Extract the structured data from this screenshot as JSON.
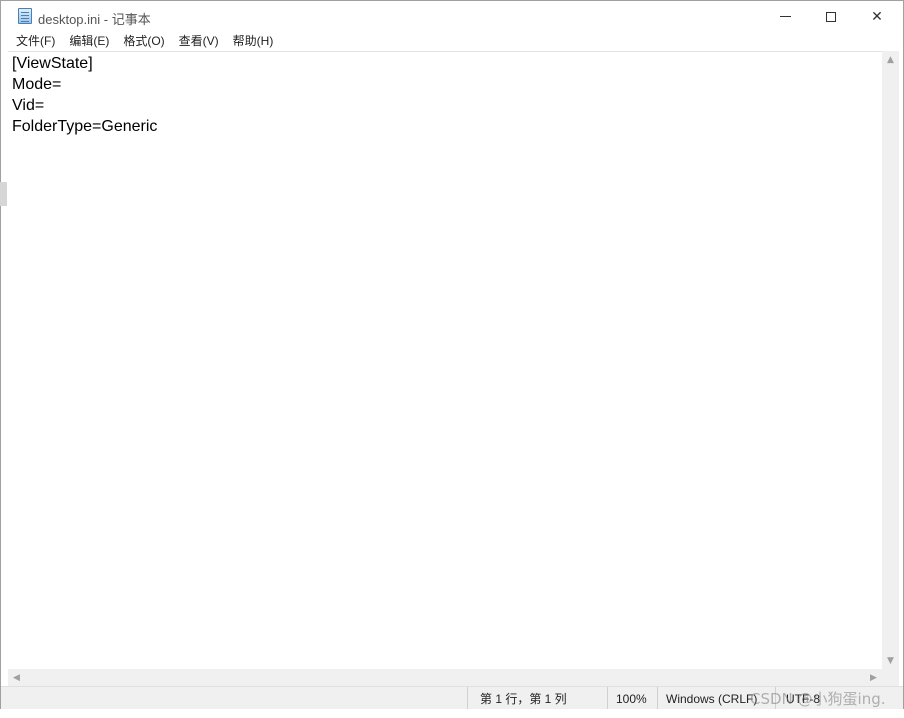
{
  "window": {
    "title": "desktop.ini - 记事本"
  },
  "menu": [
    {
      "label": "文件(F)"
    },
    {
      "label": "编辑(E)"
    },
    {
      "label": "格式(O)"
    },
    {
      "label": "查看(V)"
    },
    {
      "label": "帮助(H)"
    }
  ],
  "editor": {
    "lines": [
      "[ViewState]",
      "Mode=",
      "Vid=",
      "FolderType=Generic"
    ]
  },
  "status": {
    "position": "第 1 行，第 1 列",
    "zoom": "100%",
    "line_ending": "Windows (CRLF)",
    "encoding": "UTF-8"
  },
  "watermark": "CSDN @小狗蛋ing.",
  "colors": {
    "background": "#ffffff",
    "status_bar": "#f0f0f0",
    "text": "#000000"
  }
}
